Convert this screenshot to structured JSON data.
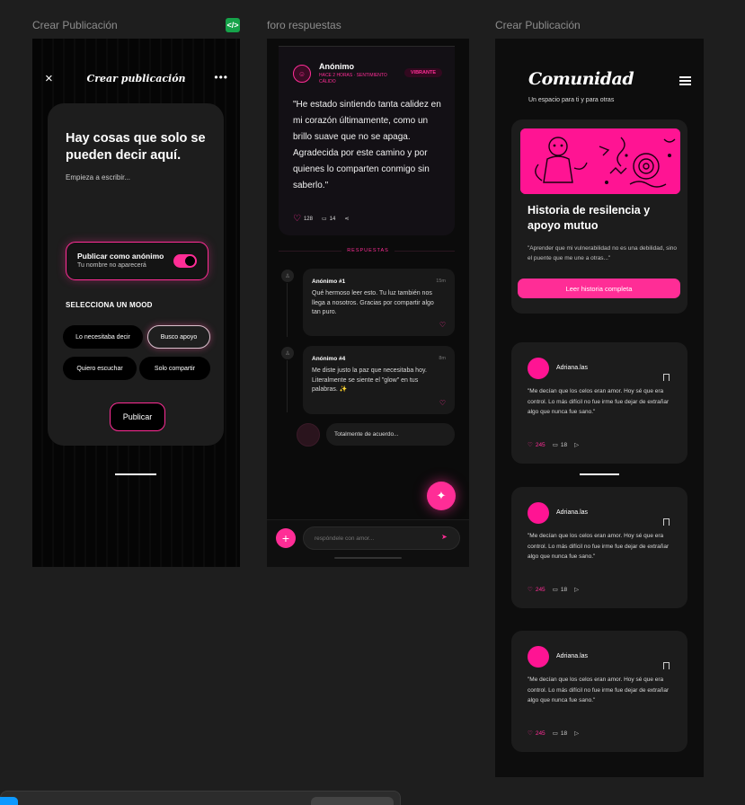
{
  "frame_labels": {
    "f1": "Crear Publicación",
    "f2": "foro respuestas",
    "f3": "Crear Publicación"
  },
  "code_badge": "</>",
  "create_post": {
    "close_icon": "×",
    "title": "Crear publicación",
    "more_icon": "•••",
    "heading": "Hay cosas que solo se pueden decir aquí.",
    "textarea_placeholder": "Empieza a escribir...",
    "anonymous": {
      "title": "Publicar como anónimo",
      "subtitle": "Tu nombre no aparecerá",
      "enabled": true
    },
    "mood_title": "SELECCIONA UN MOOD",
    "moods": [
      "Lo necesitaba decir",
      "Busco apoyo",
      "Quiero escuchar",
      "Solo compartir"
    ],
    "selected_mood": "Busco apoyo",
    "publish": "Publicar"
  },
  "forum": {
    "post": {
      "author": "Anónimo",
      "meta": "HACE 2 HORAS · SENTIMIENTO CÁLIDO",
      "badge": "VIBRANTE",
      "text": "\"He estado sintiendo tanta calidez en mi corazón últimamente, como un brillo suave que no se apaga. Agradecida por este camino y por quienes lo comparten conmigo sin saberlo.\"",
      "likes": "128",
      "comments": "14"
    },
    "responses_label": "RESPUESTAS",
    "replies": [
      {
        "name": "Anónimo #1",
        "time": "15m",
        "text": "Qué hermoso leer esto. Tu luz también nos llega a nosotros. Gracias por compartir algo tan puro."
      },
      {
        "name": "Anónimo #4",
        "time": "8m",
        "text": "Me diste justo la paz que necesitaba hoy. Literalmente se siente el \"glow\" en tus palabras. ✨"
      }
    ],
    "quick_reply": "Totalmente de acuerdo...",
    "fab_icon": "✦",
    "plus_icon": "+",
    "input_placeholder": "respóndele con amor...",
    "send_icon": "➤"
  },
  "community": {
    "brand": "Comunidad",
    "tagline": "Un espacio para ti y para otras",
    "story": {
      "title": "Historia de resilencia y apoyo mutuo",
      "quote": "\"Aprender que mi vulnerabilidad no es una debilidad, sino el puente que me une a otras...\"",
      "button": "Leer historia completa"
    },
    "feed": [
      {
        "user": "Adriana.las",
        "text": "\"Me decían que los celos eran amor. Hoy sé que era control. Lo más difícil no fue irme fue dejar de extrañar algo que nunca fue sano.\"",
        "likes": "245",
        "comments": "18"
      },
      {
        "user": "Adriana.las",
        "text": "\"Me decían que los celos eran amor. Hoy sé que era control. Lo más difícil no fue irme fue dejar de extrañar algo que nunca fue sano.\"",
        "likes": "245",
        "comments": "18"
      },
      {
        "user": "Adriana.las",
        "text": "\"Me decían que los celos eran amor. Hoy sé que era control. Lo más difícil no fue irme fue dejar de extrañar algo que nunca fue sano.\"",
        "likes": "245",
        "comments": "18"
      }
    ]
  },
  "colors": {
    "accent": "#ff2d96",
    "background": "#1e1e1e",
    "card": "#1c1c1c"
  }
}
